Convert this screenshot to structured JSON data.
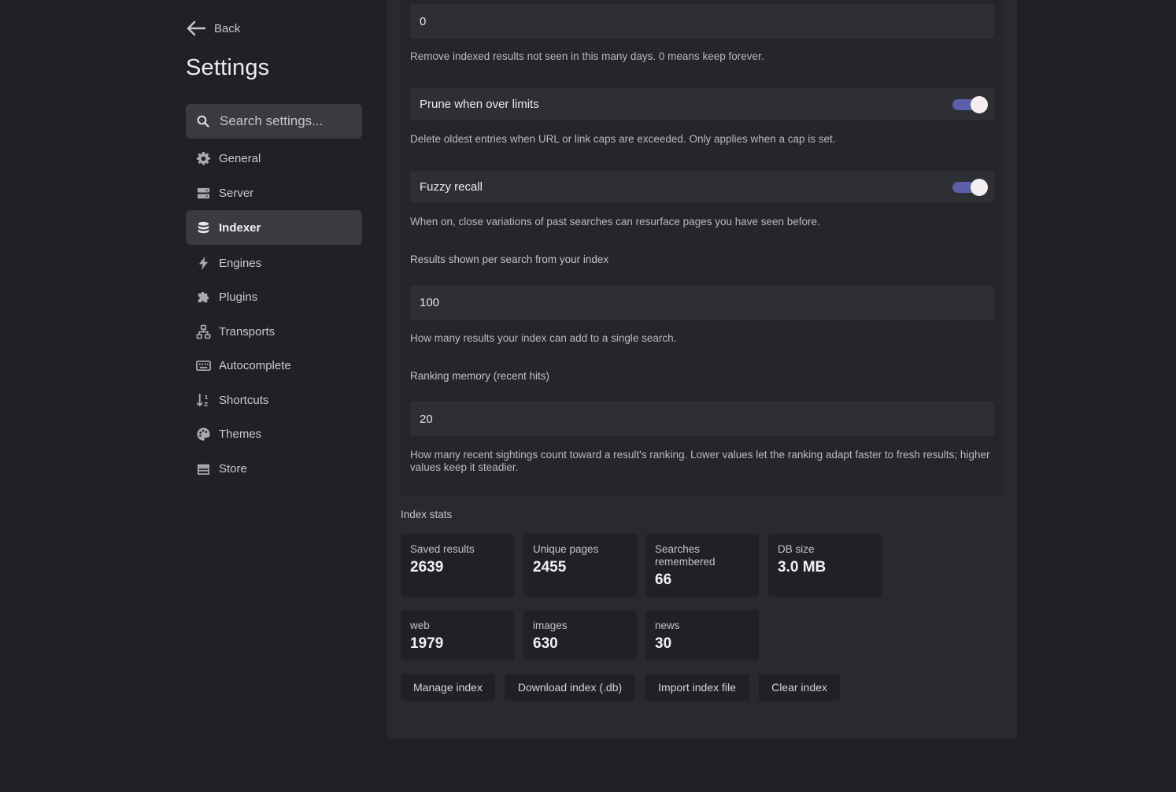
{
  "sidebar": {
    "back_label": "Back",
    "title": "Settings",
    "search_placeholder": "Search settings...",
    "items": [
      {
        "label": "General",
        "icon": "gear-icon"
      },
      {
        "label": "Server",
        "icon": "server-icon"
      },
      {
        "label": "Indexer",
        "icon": "database-icon",
        "active": true
      },
      {
        "label": "Engines",
        "icon": "bolt-icon"
      },
      {
        "label": "Plugins",
        "icon": "puzzle-icon"
      },
      {
        "label": "Transports",
        "icon": "network-icon"
      },
      {
        "label": "Autocomplete",
        "icon": "keyboard-icon"
      },
      {
        "label": "Shortcuts",
        "icon": "sort-icon"
      },
      {
        "label": "Themes",
        "icon": "palette-icon"
      },
      {
        "label": "Store",
        "icon": "store-icon"
      }
    ]
  },
  "indexer": {
    "retention_value": "0",
    "retention_help": "Remove indexed results not seen in this many days. 0 means keep forever.",
    "prune_label": "Prune when over limits",
    "prune_help": "Delete oldest entries when URL or link caps are exceeded. Only applies when a cap is set.",
    "fuzzy_label": "Fuzzy recall",
    "fuzzy_help": "When on, close variations of past searches can resurface pages you have seen before.",
    "results_label": "Results shown per search from your index",
    "results_value": "100",
    "results_help": "How many results your index can add to a single search.",
    "ranking_label": "Ranking memory (recent hits)",
    "ranking_value": "20",
    "ranking_help": "How many recent sightings count toward a result's ranking. Lower values let the ranking adapt faster to fresh results; higher values keep it steadier."
  },
  "stats": {
    "title": "Index stats",
    "saved_results_label": "Saved results",
    "saved_results_value": "2639",
    "unique_pages_label": "Unique pages",
    "unique_pages_value": "2455",
    "searches_label": "Searches remembered",
    "searches_value": "66",
    "db_size_label": "DB size",
    "db_size_value": "3.0 MB",
    "web_label": "web",
    "web_value": "1979",
    "images_label": "images",
    "images_value": "630",
    "news_label": "news",
    "news_value": "30"
  },
  "actions": {
    "manage": "Manage index",
    "download": "Download index (.db)",
    "import": "Import index file",
    "clear": "Clear index"
  },
  "colors": {
    "toggle_on": "#5b5fa8",
    "background": "#202126",
    "panel": "#292a2e"
  }
}
